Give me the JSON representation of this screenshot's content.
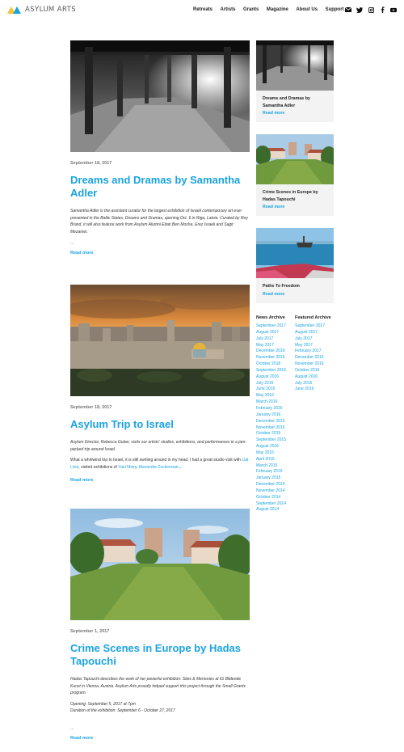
{
  "brand": {
    "name": "ASYLUM ARTS"
  },
  "nav": [
    "Retreats",
    "Artists",
    "Grants",
    "Magazine",
    "About Us",
    "Support"
  ],
  "social_icons": [
    "mail-icon",
    "twitter-icon",
    "instagram-icon",
    "facebook-icon",
    "youtube-icon"
  ],
  "colors": {
    "accent": "#1aa3e0",
    "logo_yellow": "#f4c430",
    "card_bg": "#f3f3f3"
  },
  "posts": [
    {
      "date": "September 18, 2017",
      "title": "Dreams and Dramas by Samantha Adler",
      "excerpt": "Samantha Adler is the assistant curator for the largest exhibition of Israeli contemporary art ever presented in the Baltic States, Dreams and Dramas, opening Oct. 6 in Riga, Latvia. Curated by Roy Brand, it will also feature work from Asylum Alumni Eitan Ben Moshe, Erez Israeli and Sagit Mezamer.",
      "ellipsis": "...",
      "read_more": "Read more"
    },
    {
      "date": "September 18, 2017",
      "title": "Asylum Trip to Israel",
      "excerpt": "Asylum Director, Rebecca Guber, visits our artists' studios, exhibitions, and performances in a jam-packed trip around Israel.",
      "body_before": "What a whirlwind trip to Israel, it is still swirling around in my head. I had a great studio visit with ",
      "link1": "Liat Livni",
      "body_middle": ", visited exhibitions of ",
      "link2": "Yael Meiry",
      "sep": ", ",
      "link3": "Alexandre Zuckerman",
      "body_after": "...",
      "read_more": "Read more"
    },
    {
      "date": "September 1, 2017",
      "title": "Crime Scenes in Europe by Hadas Tapouchi",
      "excerpt": "Hadas Tapouchi describes the work of her powerful exhibition: Sites & Memories at IG Bildende Kunst in Vienna, Austria. Asylum Arts proudly helped support this project through the Small Grants program.",
      "opening": "Opening: September 5, 2017 at 7pm",
      "duration": "Duration of the exhibition: September 6 - October 27, 2017",
      "ellipsis": "...",
      "read_more": "Read more"
    }
  ],
  "sidebar_cards": [
    {
      "title": "Dreams and Dramas by Samantha Adler",
      "read_more": "Read more"
    },
    {
      "title": "Crime Scenes in Europe by Hadas Tapouchi",
      "read_more": "Read more"
    },
    {
      "title": "Paths To Freedom",
      "read_more": "Read more"
    }
  ],
  "news_archive": {
    "heading": "News Archive",
    "items": [
      "September 2017",
      "August 2017",
      "July 2017",
      "May 2017",
      "December 2016",
      "November 2016",
      "October 2016",
      "September 2016",
      "August 2016",
      "July 2016",
      "June 2016",
      "May 2016",
      "March 2016",
      "February 2016",
      "January 2016",
      "December 2015",
      "November 2015",
      "October 2015",
      "September 2015",
      "August 2015",
      "May 2015",
      "April 2015",
      "March 2015",
      "February 2015",
      "January 2015",
      "December 2014",
      "November 2014",
      "October 2014",
      "September 2014",
      "August 2014"
    ]
  },
  "featured_archive": {
    "heading": "Featured Archive",
    "items": [
      "September 2017",
      "August 2017",
      "July 2017",
      "May 2017",
      "February 2017",
      "December 2016",
      "November 2016",
      "October 2016",
      "August 2016",
      "July 2016",
      "June 2016"
    ]
  }
}
